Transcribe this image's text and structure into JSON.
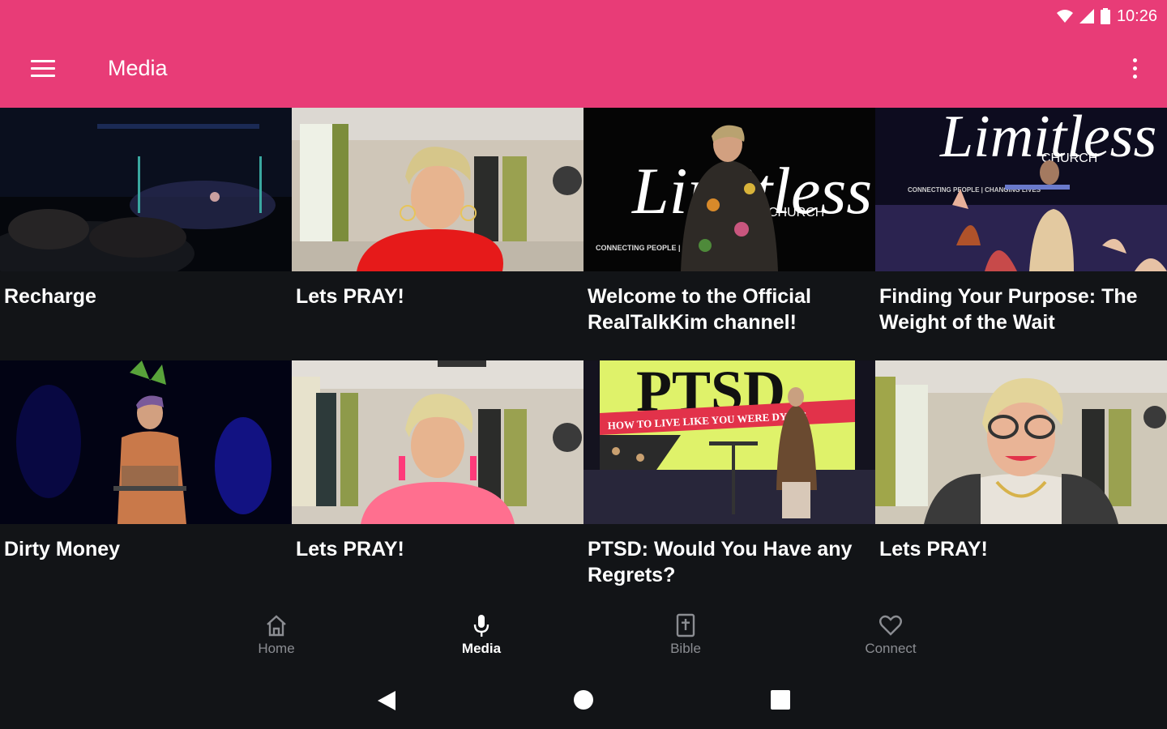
{
  "status": {
    "time": "10:26",
    "wifi_icon": "wifi-icon",
    "signal_icon": "signal-icon",
    "battery_icon": "battery-icon"
  },
  "appbar": {
    "title": "Media",
    "menu_icon": "hamburger-menu-icon",
    "overflow_icon": "more-vert-icon",
    "color": "#e83c77"
  },
  "media": {
    "items": [
      {
        "title": "Recharge"
      },
      {
        "title": "Lets PRAY!"
      },
      {
        "title": "Welcome to the Official RealTalkKim channel!"
      },
      {
        "title": "Finding Your Purpose: The Weight of the Wait"
      },
      {
        "title": "Dirty Money"
      },
      {
        "title": "Lets PRAY!"
      },
      {
        "title": "PTSD: Would You Have any Regrets?"
      },
      {
        "title": "Lets PRAY!"
      }
    ]
  },
  "thumb_text": {
    "limitless_script": "Limitless",
    "church": "CHURCH",
    "connecting": "CONNECTING PEOPLE | CHANGING LIVES",
    "ptsd": "PTSD",
    "ptsd_sub": "HOW TO LIVE LIKE YOU WERE DYING"
  },
  "bottom_nav": {
    "items": [
      {
        "label": "Home",
        "icon": "home-icon"
      },
      {
        "label": "Media",
        "icon": "microphone-icon",
        "active": true
      },
      {
        "label": "Bible",
        "icon": "bible-icon"
      },
      {
        "label": "Connect",
        "icon": "heart-icon"
      }
    ]
  },
  "system_nav": {
    "back_icon": "back-triangle-icon",
    "home_icon": "home-circle-icon",
    "recents_icon": "recents-square-icon"
  }
}
